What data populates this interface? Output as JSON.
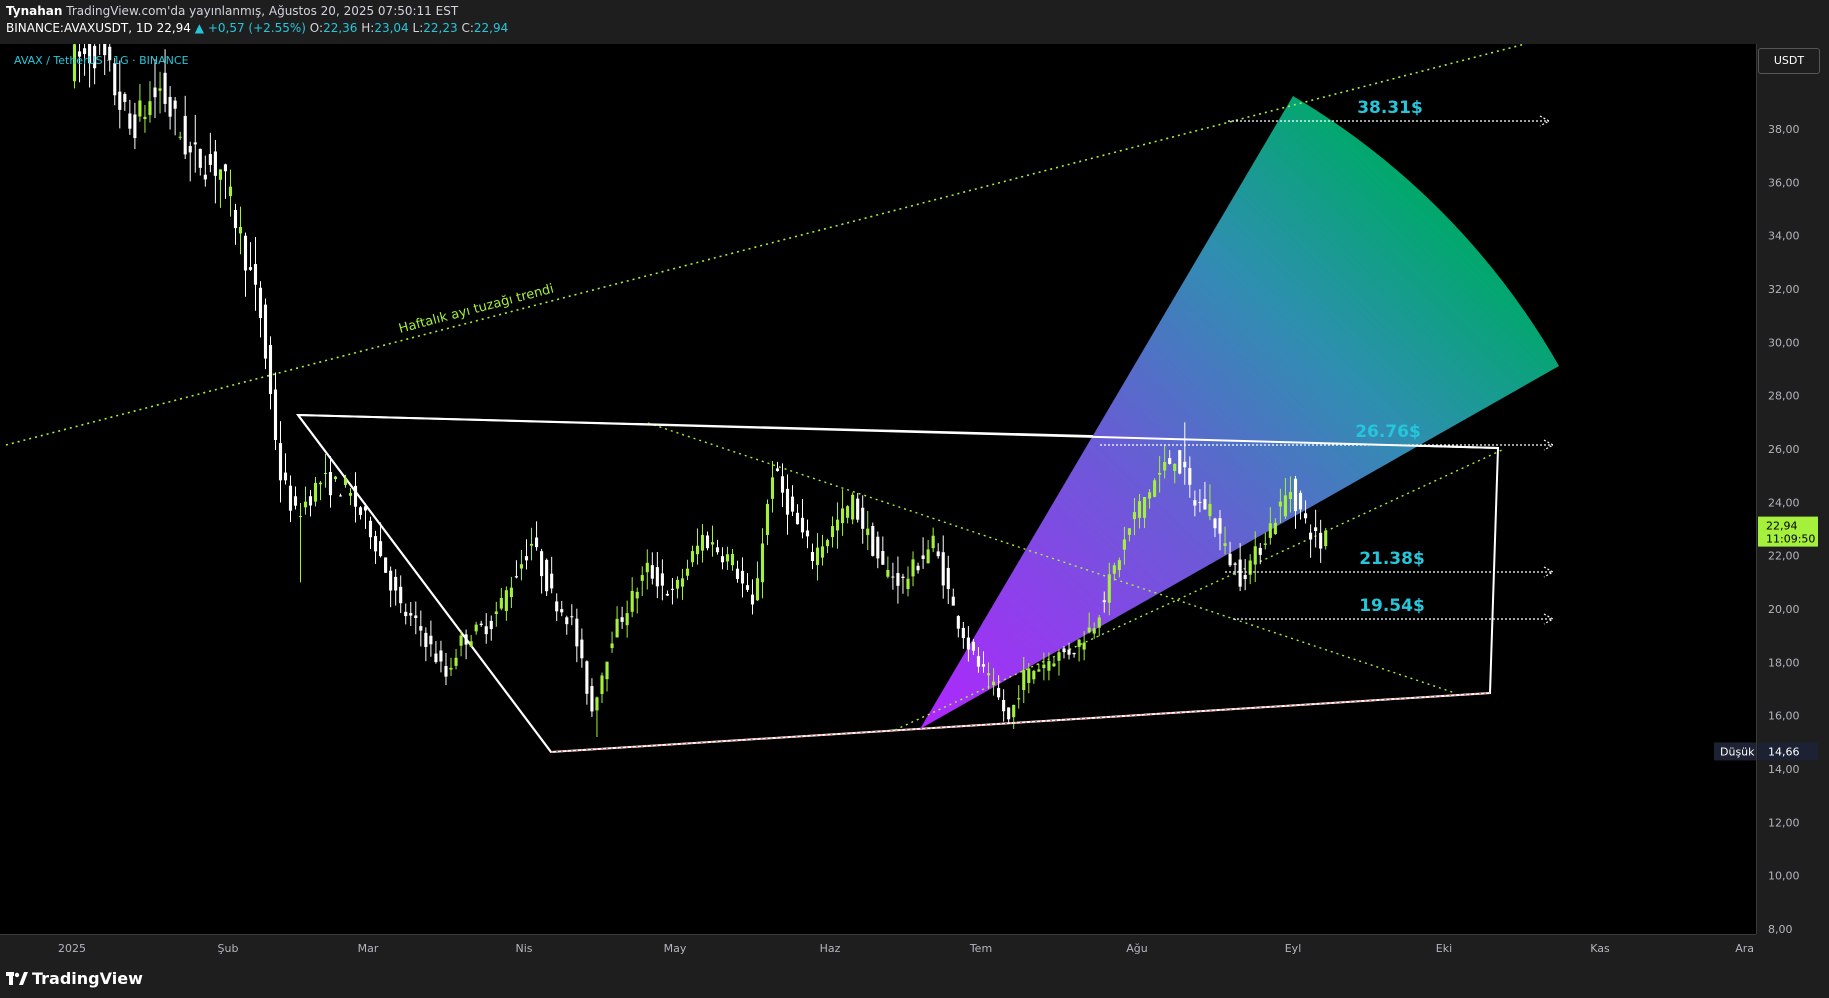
{
  "header": {
    "author": "Tynahan",
    "published": "TradingView.com'da yayınlanmış, Ağustos 20, 2025 07:50:11 EST",
    "symbol": "BINANCE:AVAXUSDT, 1D",
    "last": "22,94",
    "change": "+0,57 (+2.55%)",
    "o_label": "O:",
    "o_val": "22,36",
    "h_label": "H:",
    "h_val": "23,04",
    "l_label": "L:",
    "l_val": "22,23",
    "c_label": "C:",
    "c_val": "22,94"
  },
  "legend_title": "AVAX / TetherUS · 1G · BINANCE",
  "currency_button": "USDT",
  "footer": {
    "brand": "TradingView"
  },
  "colors": {
    "up": "#a5f03c",
    "down": "#ffffff",
    "accent": "#26c6da",
    "trend": "#a5f03c",
    "background": "#000000"
  },
  "chart_data": {
    "type": "candlestick",
    "symbol": "AVAX / TetherUS",
    "timeframe": "1G",
    "exchange": "BINANCE",
    "x_labels": [
      "2025",
      "Şub",
      "Mar",
      "Nis",
      "May",
      "Haz",
      "Tem",
      "Ağu",
      "Eyl",
      "Eki",
      "Kas",
      "Ara"
    ],
    "y_ticks": [
      "8,00",
      "10,00",
      "12,00",
      "14,00",
      "16,00",
      "18,00",
      "20,00",
      "22,00",
      "24,00",
      "26,00",
      "28,00",
      "30,00",
      "32,00",
      "34,00",
      "36,00",
      "38,00"
    ],
    "ylim": [
      8,
      40
    ],
    "last_price": "22,94",
    "countdown": "11:09:50",
    "low_label": "Düşük",
    "low_value": "14,66",
    "targets": [
      {
        "label": "38.31$",
        "value": 38.31
      },
      {
        "label": "26.76$",
        "value": 26.76
      },
      {
        "label": "21.38$",
        "value": 21.38
      },
      {
        "label": "19.54$",
        "value": 19.54
      }
    ],
    "trend_label": "Haftalık ayı tuzağı trendi",
    "key_closes_monthly": [
      {
        "month": "2025-01",
        "open": 39.0,
        "close": 33.5
      },
      {
        "month": "2025-02",
        "open": 33.0,
        "close": 20.5
      },
      {
        "month": "2025-03",
        "open": 20.5,
        "close": 18.0
      },
      {
        "month": "2025-04",
        "open": 19.5,
        "close": 21.5
      },
      {
        "month": "2025-05",
        "open": 22.0,
        "close": 22.0
      },
      {
        "month": "2025-06",
        "open": 21.0,
        "close": 17.5
      },
      {
        "month": "2025-07",
        "open": 17.5,
        "close": 24.0
      },
      {
        "month": "2025-08",
        "open": 24.0,
        "close": 22.94
      }
    ]
  }
}
